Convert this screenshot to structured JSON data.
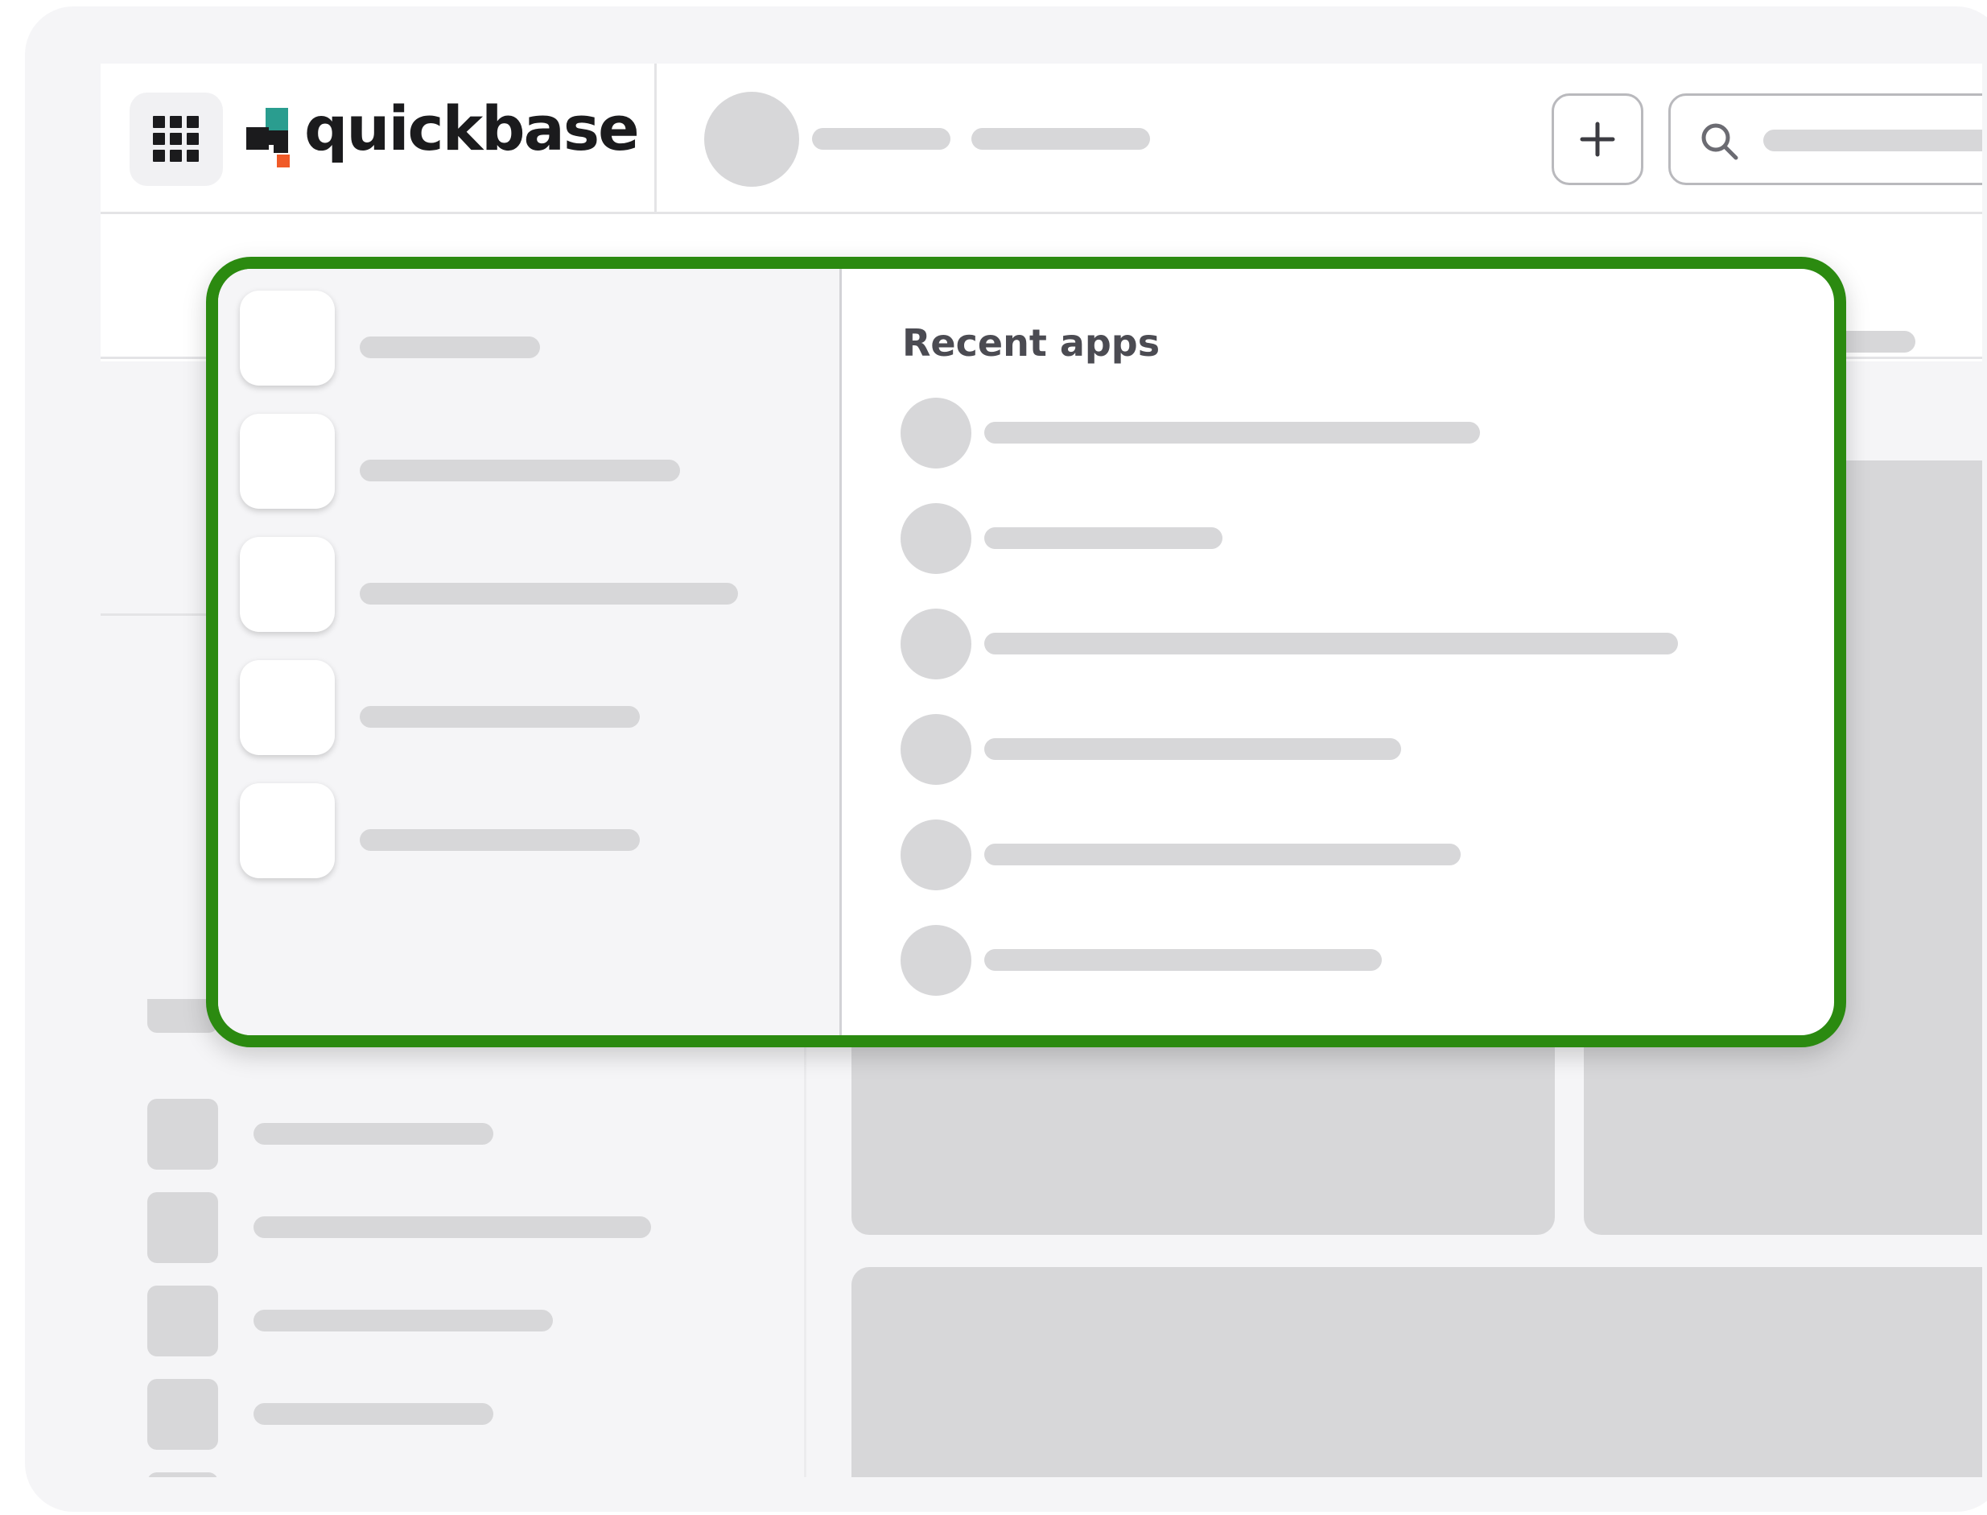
{
  "brand": {
    "name": "quickbase",
    "colors": {
      "teal": "#2a9d8f",
      "orange": "#f05a28",
      "dark": "#1b1b1d"
    }
  },
  "icons": {
    "app_grid": "grid-icon",
    "add": "plus-icon",
    "search": "search-icon"
  },
  "app_switcher": {
    "highlight_color": "#2b8a10",
    "recent_apps_title": "Recent apps"
  }
}
